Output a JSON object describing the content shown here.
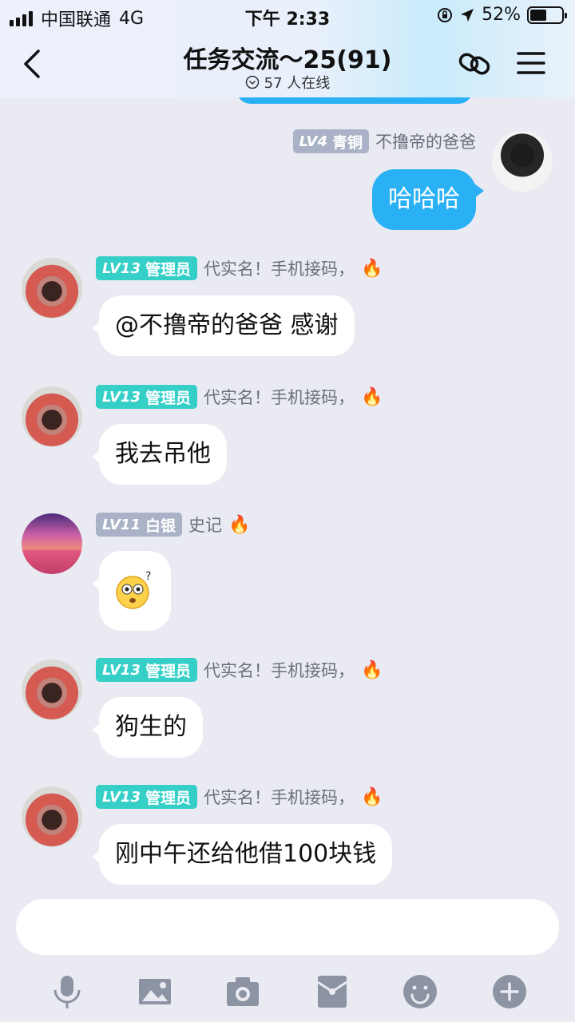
{
  "status_bar": {
    "carrier": "中国联通",
    "network": "4G",
    "time": "下午 2:33",
    "battery": "52%",
    "battery_level": 0.52
  },
  "header": {
    "title": "任务交流～25(91)",
    "online": "57 人在线"
  },
  "colors": {
    "accent_blue": "#29b0f5",
    "admin_badge": "#36cfc7",
    "member_badge": "#a9b2c6"
  },
  "messages": [
    {
      "lv": "LV4",
      "role": "青铜",
      "nick": "不撸帝的爸爸",
      "text": "哈哈哈"
    },
    {
      "lv": "LV13",
      "role": "管理员",
      "nick": "代实名！手机接码，",
      "text": "@不撸帝的爸爸 感谢"
    },
    {
      "lv": "LV13",
      "role": "管理员",
      "nick": "代实名！手机接码，",
      "text": "我去吊他"
    },
    {
      "lv": "LV11",
      "role": "白银",
      "nick": "史记",
      "text": ""
    },
    {
      "lv": "LV13",
      "role": "管理员",
      "nick": "代实名！手机接码，",
      "text": "狗生的"
    },
    {
      "lv": "LV13",
      "role": "管理员",
      "nick": "代实名！手机接码，",
      "text": "刚中午还给他借100块钱"
    }
  ],
  "toolbar": {
    "icons": [
      "microphone-icon",
      "image-icon",
      "camera-icon",
      "red-packet-icon",
      "emoji-icon",
      "plus-icon"
    ]
  }
}
